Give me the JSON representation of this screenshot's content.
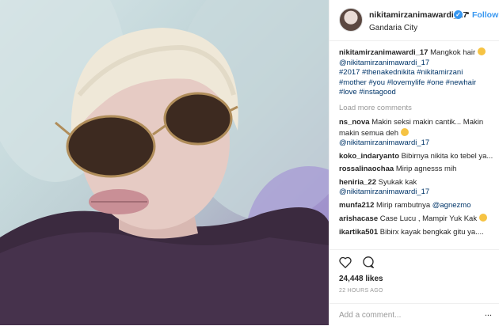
{
  "header": {
    "username": "nikitamirzanimawardi_17",
    "follow": "Followi",
    "dot": "•",
    "location": "Gandaria City"
  },
  "caption": {
    "username": "nikitamirzanimawardi_17",
    "text": "Mangkok hair",
    "mention": "@nikitamirzanimawardi_17",
    "tags_line1": "#2017 #thenakednikita #nikitamirzani",
    "tags_line2": "#mother #you #lovemylife #one #newhair",
    "tags_line3": "#love #instagood"
  },
  "load_more": "Load more comments",
  "comments": [
    {
      "user": "ns_nova",
      "text": "Makin seksi makin cantik... Makin makin semua deh",
      "mention": "@nikitamirzanimawardi_17"
    },
    {
      "user": "koko_indaryanto",
      "text": "Bibirnya nikita ko tebel ya..."
    },
    {
      "user": "rossalinaochaa",
      "text": "Mirip agnesss mih"
    },
    {
      "user": "heniria_22",
      "text": "Syukak kak",
      "mention": "@nikitamirzanimawardi_17"
    },
    {
      "user": "munfa212",
      "text": "Mirip rambutnya",
      "mention": "@agnezmo"
    },
    {
      "user": "arishacase",
      "text": "Case Lucu , Mampir Yuk Kak"
    },
    {
      "user": "ikartika501",
      "text": "Bibirx kayak bengkak gitu ya...."
    }
  ],
  "actions": {
    "likes": "24,448 likes",
    "time": "22 HOURS AGO",
    "add_comment_placeholder": "Add a comment...",
    "more": "..."
  },
  "icons": [
    "verified-badge-icon",
    "heart-icon",
    "comment-icon",
    "emoji-icon"
  ],
  "colors": {
    "accent": "#3897f0",
    "hashtag": "#003569",
    "muted": "#999999"
  }
}
